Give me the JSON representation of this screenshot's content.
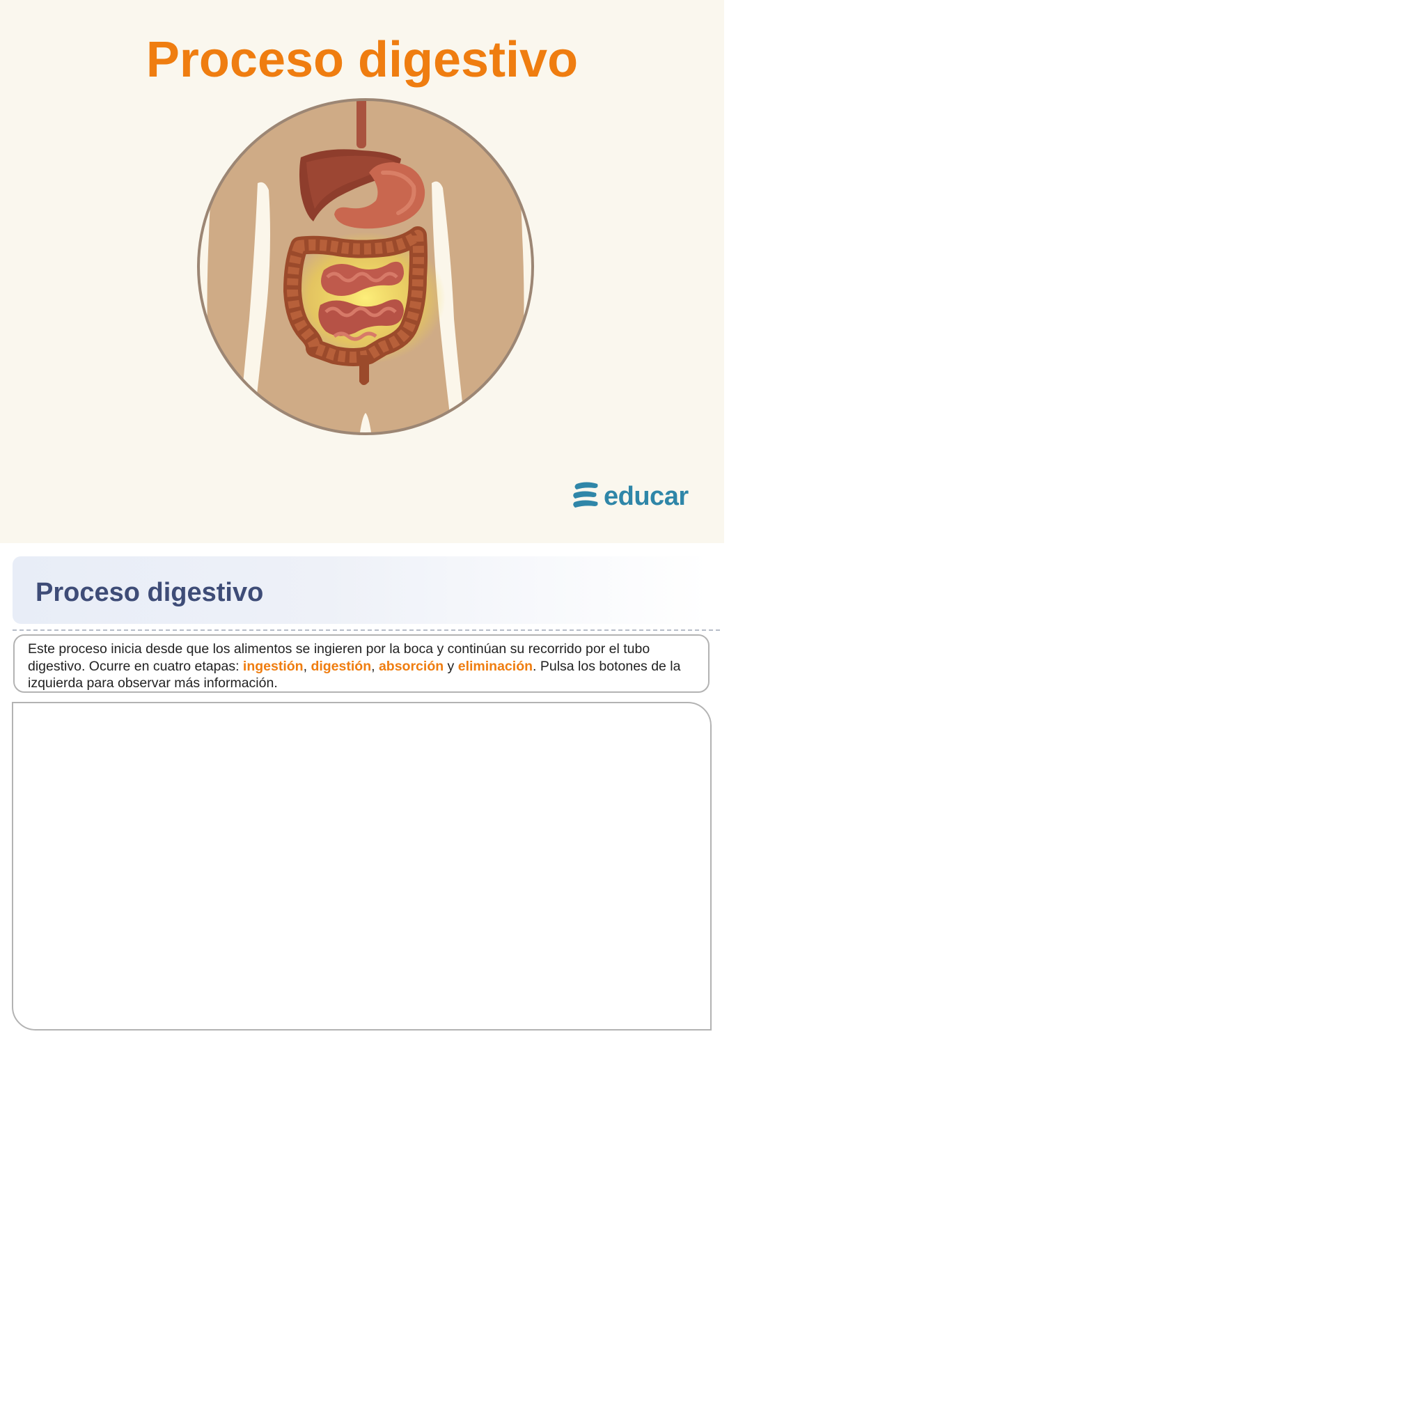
{
  "hero": {
    "title": "Proceso digestivo",
    "image": "digestive-system-illustration",
    "colors": {
      "background": "#faf7ee",
      "title": "#ef7d10",
      "skin": "#cfab86",
      "circle": "#9c8674"
    }
  },
  "logo": {
    "text": "educar",
    "color": "#2f86a8"
  },
  "section": {
    "title": "Proceso digestivo",
    "title_color": "#3e4c77"
  },
  "intro": {
    "before": "Este proceso inicia desde que los alimentos se ingieren por  la boca y continúan  su recorrido por el tubo digestivo. Ocurre en cuatro etapas: ",
    "stage1": "ingestión",
    "sep1": ", ",
    "stage2": "digestión",
    "sep2": ", ",
    "stage3": "absorción",
    "sep3": " y ",
    "stage4": "eliminación",
    "after": ". Pulsa los botones de la izquierda para observar más información.",
    "highlight_color": "#ef7d10"
  },
  "content_panel": {
    "state": "empty"
  }
}
